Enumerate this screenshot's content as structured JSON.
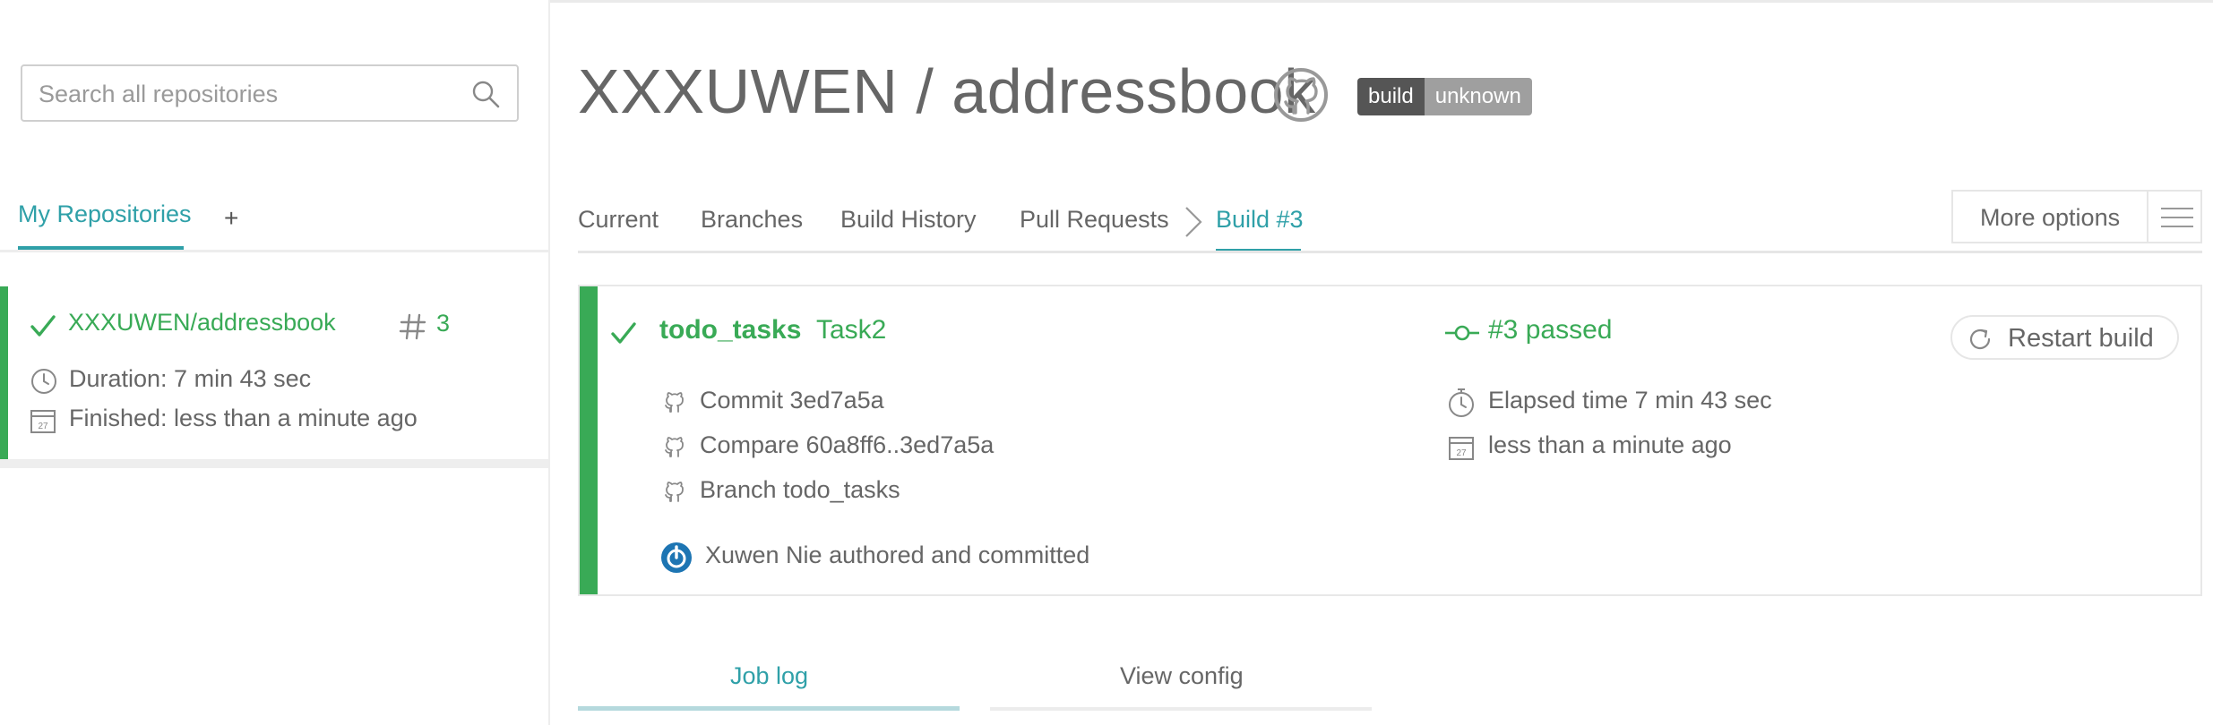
{
  "sidebar": {
    "search": {
      "placeholder": "Search all repositories",
      "value": ""
    },
    "tabs": [
      {
        "label": "My Repositories",
        "active": true
      },
      {
        "label": "+"
      }
    ],
    "repos": [
      {
        "name": "XXXUWEN/addressbook",
        "build_number": "3",
        "duration": "Duration: 7 min 43 sec",
        "finished": "Finished: less than a minute ago",
        "status": "passed",
        "status_color": "#39aa56"
      }
    ]
  },
  "header": {
    "title": "XXXUWEN / addressbook",
    "badge": {
      "left": "build",
      "right": "unknown"
    }
  },
  "nav": {
    "tabs": [
      {
        "label": "Current"
      },
      {
        "label": "Branches"
      },
      {
        "label": "Build History"
      },
      {
        "label": "Pull Requests"
      },
      {
        "label": "Build #3",
        "active": true
      }
    ],
    "more_options": "More options"
  },
  "build": {
    "branch": "todo_tasks",
    "message": "Task2",
    "status_text": "#3 passed",
    "restart_label": "Restart build",
    "commit": "Commit 3ed7a5a",
    "compare": "Compare 60a8ff6..3ed7a5a",
    "branch_line": "Branch todo_tasks",
    "author": "Xuwen Nie authored and committed",
    "elapsed": "Elapsed time 7 min 43 sec",
    "finished": "less than a minute ago",
    "calendar_day": "27"
  },
  "log_tabs": [
    {
      "label": "Job log",
      "active": true
    },
    {
      "label": "View config"
    }
  ],
  "colors": {
    "accent": "#2fa0a8",
    "success": "#39aa56",
    "text": "#666666",
    "badge_dark": "#555555",
    "badge_light": "#9f9f9f"
  },
  "icons": [
    "search-icon",
    "check-icon",
    "hash-icon",
    "clock-icon",
    "calendar-icon",
    "github-icon",
    "chevron-right-icon",
    "menu-icon",
    "commit-icon",
    "restart-icon",
    "stopwatch-icon",
    "avatar"
  ]
}
